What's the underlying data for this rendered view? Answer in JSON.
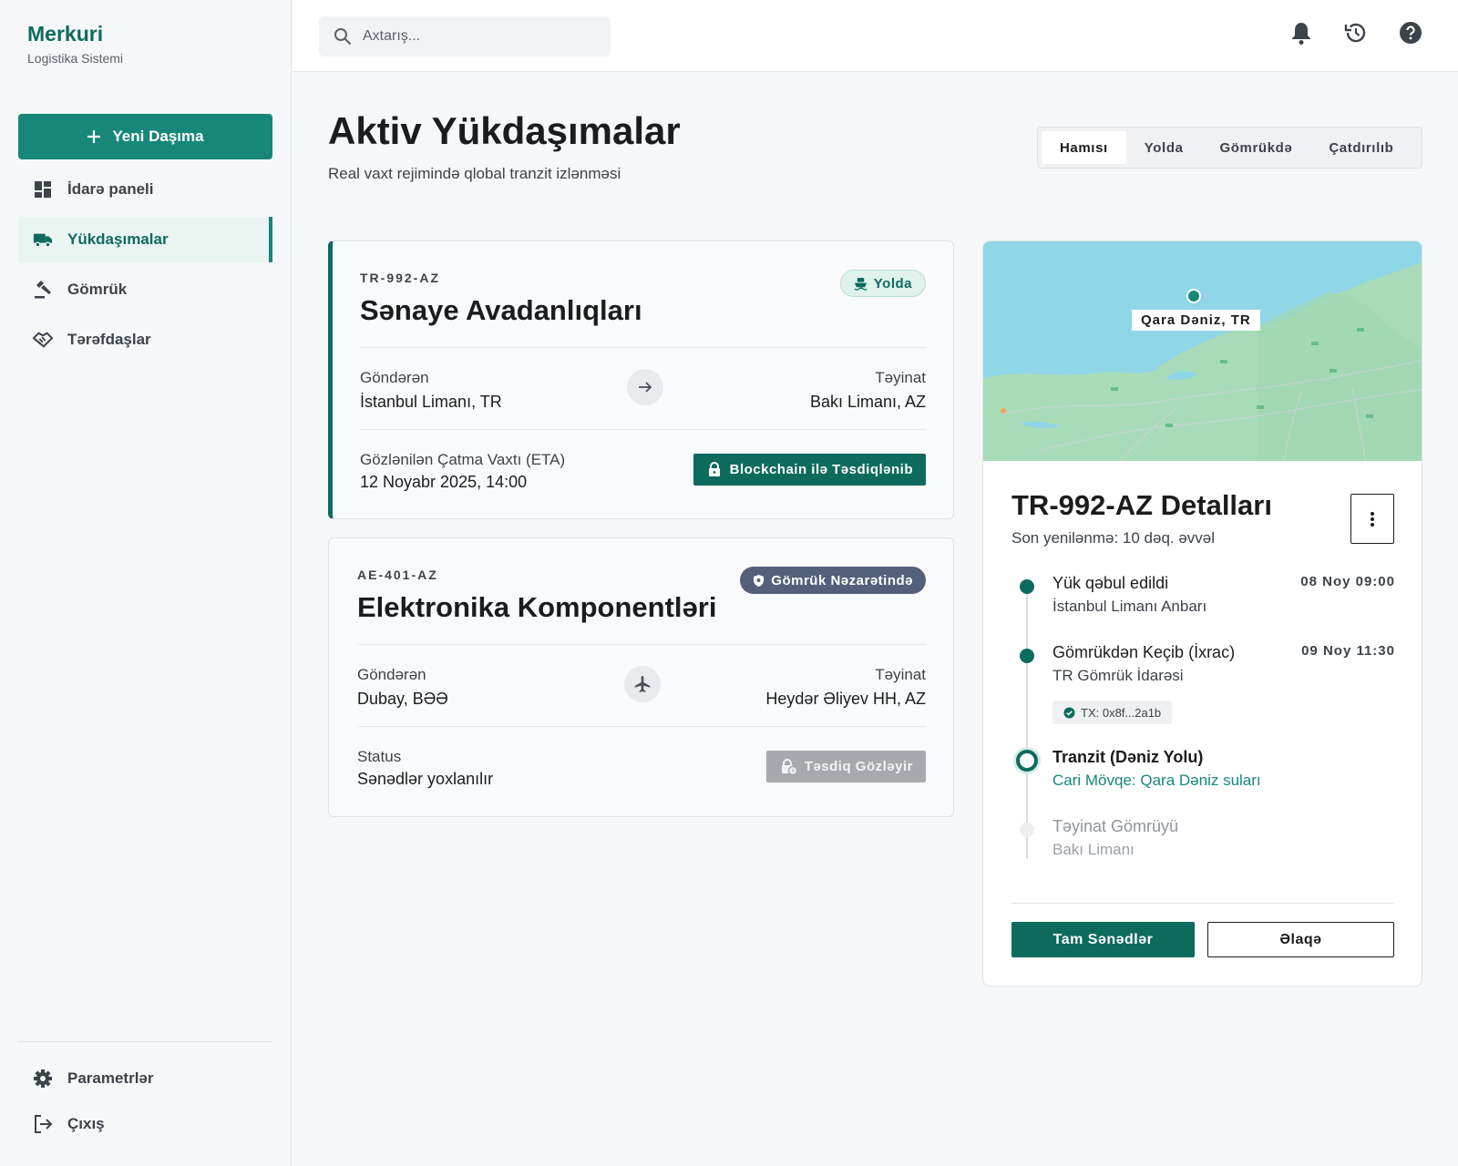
{
  "brand": {
    "title": "Merkuri",
    "subtitle": "Logistika Sistemi"
  },
  "sidebar": {
    "new_button": "Yeni Daşıma",
    "items": [
      {
        "label": "İdarə paneli",
        "icon": "dashboard-icon",
        "active": false
      },
      {
        "label": "Yükdaşımalar",
        "icon": "truck-icon",
        "active": true
      },
      {
        "label": "Gömrük",
        "icon": "gavel-icon",
        "active": false
      },
      {
        "label": "Tərəfdaşlar",
        "icon": "handshake-icon",
        "active": false
      }
    ],
    "bottom": [
      {
        "label": "Parametrlər",
        "icon": "gear-icon"
      },
      {
        "label": "Çıxış",
        "icon": "logout-icon"
      }
    ]
  },
  "topbar": {
    "search_placeholder": "Axtarış...",
    "icons": [
      "bell-icon",
      "history-icon",
      "help-icon"
    ]
  },
  "header": {
    "title": "Aktiv Yükdaşımalar",
    "subtitle": "Real vaxt rejimində qlobal tranzit izlənməsi",
    "filters": [
      "Hamısı",
      "Yolda",
      "Gömrükdə",
      "Çatdırılıb"
    ],
    "active_filter": "Hamısı"
  },
  "shipments": [
    {
      "id": "TR-992-AZ",
      "name": "Sənaye Avadanlıqları",
      "status": "Yolda",
      "status_icon": "ship-icon",
      "from_label": "Göndərən",
      "from": "İstanbul Limanı, TR",
      "to_label": "Təyinat",
      "to": "Bakı Limanı, AZ",
      "transport_icon": "arrow-right-icon",
      "info_label": "Gözlənilən Çatma Vaxtı (ETA)",
      "info_value": "12 Noyabr 2025, 14:00",
      "action": "Blockchain ilə Təsdiqlənib",
      "action_icon": "lock-icon"
    },
    {
      "id": "AE-401-AZ",
      "name": "Elektronika Komponentləri",
      "status": "Gömrük Nəzarətində",
      "status_icon": "shield-icon",
      "from_label": "Göndərən",
      "from": "Dubay, BƏƏ",
      "to_label": "Təyinat",
      "to": "Heydər Əliyev HH, AZ",
      "transport_icon": "airplane-icon",
      "info_label": "Status",
      "info_value": "Sənədlər yoxlanılır",
      "action": "Təsdiq Gözləyir",
      "action_icon": "lock-clock-icon"
    }
  ],
  "detail": {
    "map_label": "Qara Dəniz, TR",
    "title": "TR-992-AZ Detalları",
    "updated": "Son yenilənmə: 10 dəq. əvvəl",
    "timeline": [
      {
        "title": "Yük qəbul edildi",
        "sub": "İstanbul Limanı Anbarı",
        "time": "08 Noy 09:00",
        "state": "done"
      },
      {
        "title": "Gömrükdən Keçib (İxrac)",
        "sub": "TR Gömrük İdarəsi",
        "time": "09 Noy 11:30",
        "state": "done",
        "tx": "TX: 0x8f...2a1b"
      },
      {
        "title": "Tranzit (Dəniz Yolu)",
        "sub": "Cari Mövqe: Qara Dəniz suları",
        "time": "",
        "state": "current"
      },
      {
        "title": "Təyinat Gömrüyü",
        "sub": "Bakı Limanı",
        "time": "",
        "state": "pending"
      }
    ],
    "primary_button": "Tam Sənədlər",
    "secondary_button": "Əlaqə"
  },
  "colors": {
    "primary": "#0d6b5e",
    "accent": "#17877a",
    "badge_slate": "#53607a",
    "map_sea": "#8fd6e6",
    "map_land": "#a8dcb8"
  }
}
